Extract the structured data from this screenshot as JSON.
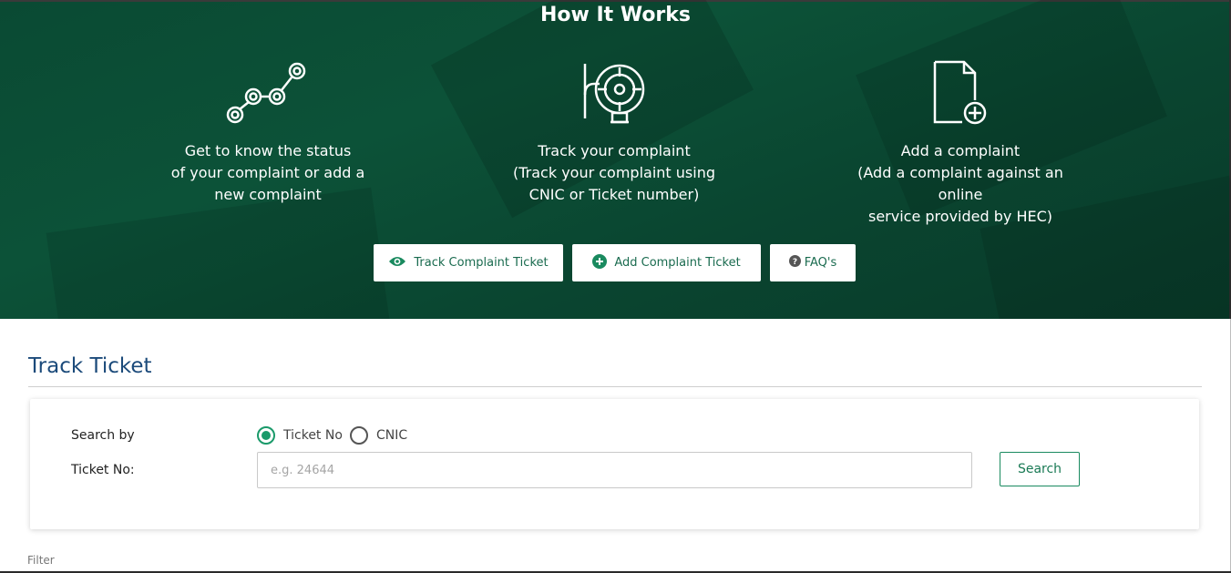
{
  "hero": {
    "title": "How It Works",
    "features": [
      {
        "icon": "progress-path-icon",
        "lines": [
          "Get to know the status",
          "of your complaint or add a",
          "new complaint"
        ]
      },
      {
        "icon": "target-track-icon",
        "lines": [
          "Track your complaint",
          "(Track your complaint using",
          "CNIC or Ticket number)"
        ]
      },
      {
        "icon": "add-document-icon",
        "lines": [
          "Add a complaint",
          "(Add a complaint against an online",
          "service provided by HEC)"
        ]
      }
    ],
    "buttons": {
      "track": "Track Complaint Ticket",
      "add": "Add Complaint Ticket",
      "faq": "FAQ's"
    }
  },
  "track": {
    "title": "Track Ticket",
    "search_by_label": "Search by",
    "options": [
      "Ticket No",
      "CNIC"
    ],
    "selected": "Ticket No",
    "ticket_label": "Ticket No:",
    "ticket_placeholder": "e.g. 24644",
    "ticket_value": "",
    "search_button": "Search"
  },
  "filter_label": "Filter",
  "colors": {
    "accent": "#1a9a6a",
    "hero_bg": "#0b4d35",
    "title_blue": "#1b4a7a"
  }
}
